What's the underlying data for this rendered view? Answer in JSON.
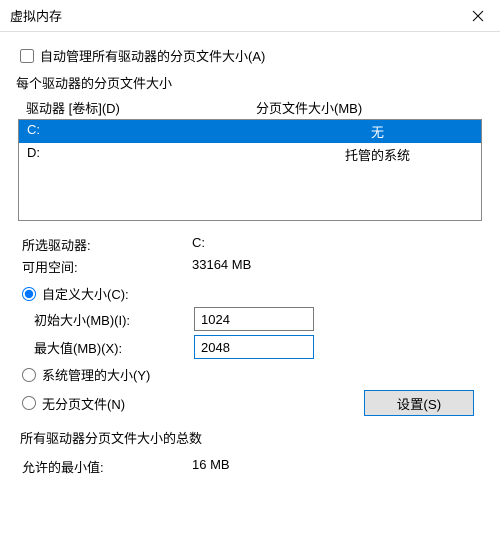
{
  "window": {
    "title": "虚拟内存"
  },
  "auto_manage": {
    "label": "自动管理所有驱动器的分页文件大小(A)",
    "checked": false
  },
  "per_drive_header": "每个驱动器的分页文件大小",
  "list_headers": {
    "drive": "驱动器 [卷标](D)",
    "size": "分页文件大小(MB)"
  },
  "drives": [
    {
      "letter": "C:",
      "status": "无",
      "selected": true
    },
    {
      "letter": "D:",
      "status": "托管的系统",
      "selected": false
    }
  ],
  "selected_drive": {
    "label": "所选驱动器:",
    "value": "C:"
  },
  "free_space": {
    "label": "可用空间:",
    "value": "33164 MB"
  },
  "radio": {
    "custom": "自定义大小(C):",
    "system": "系统管理的大小(Y)",
    "none": "无分页文件(N)",
    "selected": "custom"
  },
  "initial_size": {
    "label": "初始大小(MB)(I):",
    "value": "1024"
  },
  "max_size": {
    "label": "最大值(MB)(X):",
    "value": "2048"
  },
  "set_button": "设置(S)",
  "totals": {
    "header": "所有驱动器分页文件大小的总数",
    "min_allowed_label": "允许的最小值:",
    "min_allowed_value": "16 MB"
  }
}
